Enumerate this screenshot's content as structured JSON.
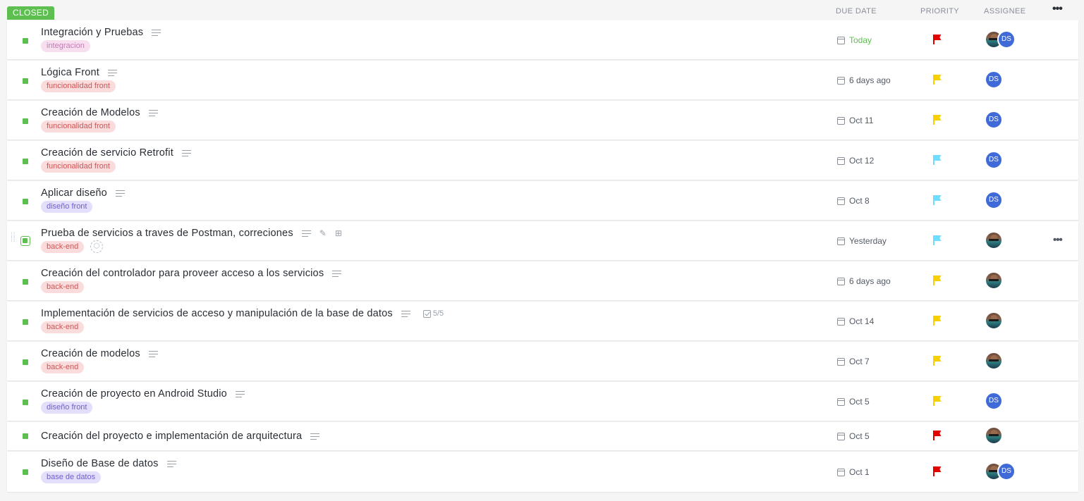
{
  "group": {
    "status_label": "CLOSED",
    "status_color": "#5cbf4f",
    "columns": {
      "due_date": "DUE DATE",
      "priority": "PRIORITY",
      "assignee": "ASSIGNEE"
    },
    "more_label": "•••"
  },
  "flag_colors": {
    "urgent": "#e50000",
    "high": "#f8d000",
    "normal": "#6fddff"
  },
  "tag_colors": {
    "integracion": {
      "bg": "#f7dff0",
      "fg": "#c07fb4"
    },
    "funcionalidad front": {
      "bg": "#fadcdc",
      "fg": "#d05454"
    },
    "diseño front": {
      "bg": "#e3defa",
      "fg": "#6f5fd0"
    },
    "back-end": {
      "bg": "#fadcdc",
      "fg": "#d05454"
    },
    "base de datos": {
      "bg": "#e3defa",
      "fg": "#6f5fd0"
    }
  },
  "tasks": [
    {
      "title": "Integración y Pruebas",
      "tag": "integracion",
      "due": "Today",
      "due_color": "#5cbf4f",
      "priority": "urgent",
      "assignees": [
        "photo",
        "ds"
      ]
    },
    {
      "title": "Lógica Front",
      "tag": "funcionalidad front",
      "due": "6 days ago",
      "priority": "high",
      "assignees": [
        "ds"
      ]
    },
    {
      "title": "Creación de Modelos",
      "tag": "funcionalidad front",
      "due": "Oct 11",
      "priority": "high",
      "assignees": [
        "ds"
      ]
    },
    {
      "title": "Creación de servicio Retrofit",
      "tag": "funcionalidad front",
      "due": "Oct 12",
      "priority": "normal",
      "assignees": [
        "ds"
      ]
    },
    {
      "title": "Aplicar diseño",
      "tag": "diseño front",
      "due": "Oct 8",
      "priority": "normal",
      "assignees": [
        "ds"
      ]
    },
    {
      "title": "Prueba de servicios a traves de Postman, correciones",
      "tag": "back-end",
      "due": "Yesterday",
      "priority": "normal",
      "assignees": [
        "photo"
      ],
      "hovered": true
    },
    {
      "title": "Creación del controlador para proveer acceso a los servicios",
      "tag": "back-end",
      "due": "6 days ago",
      "priority": "high",
      "assignees": [
        "photo"
      ]
    },
    {
      "title": "Implementación de servicios de acceso y manipulación de la base de datos",
      "tag": "back-end",
      "due": "Oct 14",
      "priority": "high",
      "assignees": [
        "photo"
      ],
      "checklist": "5/5"
    },
    {
      "title": "Creación de modelos",
      "tag": "back-end",
      "due": "Oct 7",
      "priority": "high",
      "assignees": [
        "photo"
      ]
    },
    {
      "title": "Creación de proyecto en Android Studio",
      "tag": "diseño front",
      "due": "Oct 5",
      "priority": "high",
      "assignees": [
        "ds"
      ]
    },
    {
      "title": "Creación del proyecto e implementación de arquitectura",
      "tag": null,
      "due": "Oct 5",
      "priority": "urgent",
      "assignees": [
        "photo"
      ]
    },
    {
      "title": "Diseño de Base de datos",
      "tag": "base de datos",
      "due": "Oct 1",
      "priority": "urgent",
      "assignees": [
        "photo",
        "ds"
      ]
    }
  ],
  "assignee_initials": {
    "ds": "DS"
  }
}
